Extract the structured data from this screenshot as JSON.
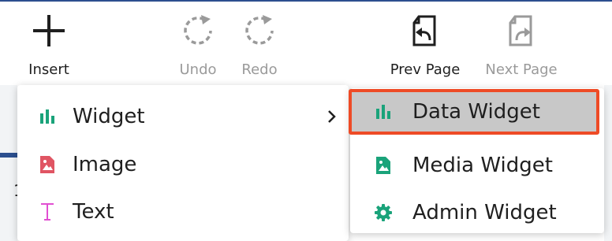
{
  "colors": {
    "accent_green": "#1aa37a",
    "image_red": "#e05563",
    "text_magenta": "#e14fd2",
    "highlight_border": "#ee4b26",
    "highlight_fill": "#c8c8c8",
    "header_blue": "#2c4f8f"
  },
  "toolbar": {
    "insert": {
      "label": "Insert",
      "icon": "plus-icon"
    },
    "undo": {
      "label": "Undo",
      "icon": "undo-icon",
      "disabled": true
    },
    "redo": {
      "label": "Redo",
      "icon": "redo-icon",
      "disabled": true
    },
    "prev_page": {
      "label": "Prev Page",
      "icon": "prev-page-icon"
    },
    "next_page": {
      "label": "Next Page",
      "icon": "next-page-icon",
      "disabled": true
    }
  },
  "background": {
    "partial_text": "1"
  },
  "insert_menu": {
    "items": [
      {
        "label": "Widget",
        "icon": "bar-chart-icon",
        "has_submenu": true
      },
      {
        "label": "Image",
        "icon": "image-file-icon"
      },
      {
        "label": "Text",
        "icon": "text-t-icon"
      }
    ]
  },
  "widget_submenu": {
    "items": [
      {
        "label": "Data Widget",
        "icon": "bar-chart-icon",
        "highlighted": true
      },
      {
        "label": "Media Widget",
        "icon": "image-file-icon"
      },
      {
        "label": "Admin Widget",
        "icon": "gear-icon"
      }
    ]
  }
}
